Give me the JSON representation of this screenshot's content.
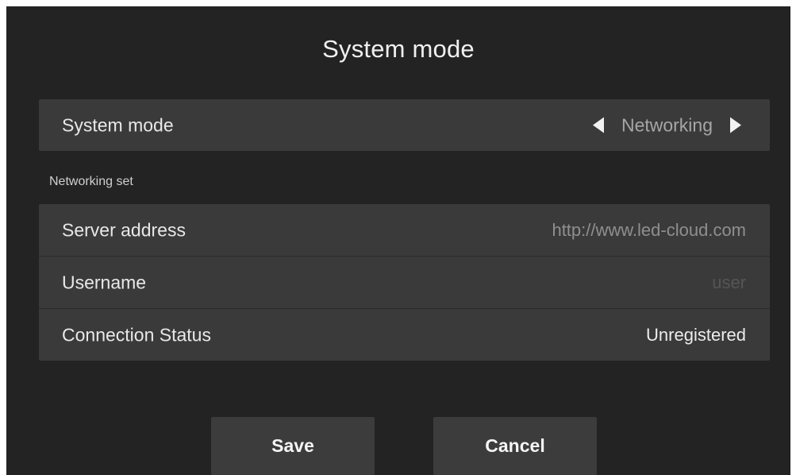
{
  "dialog": {
    "title": "System mode"
  },
  "mode": {
    "label": "System mode",
    "value": "Networking",
    "prev_icon": "triangle-left-icon",
    "next_icon": "triangle-right-icon"
  },
  "section": {
    "label": "Networking set"
  },
  "network": {
    "rows": [
      {
        "label": "Server address",
        "value": "http://www.led-cloud.com"
      },
      {
        "label": "Username",
        "value": "user"
      },
      {
        "label": "Connection Status",
        "value": "Unregistered"
      }
    ]
  },
  "buttons": {
    "save_label": "Save",
    "cancel_label": "Cancel"
  }
}
